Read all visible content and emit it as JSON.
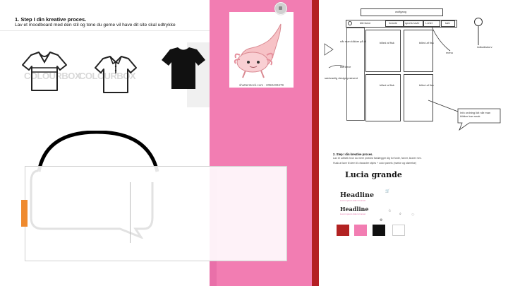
{
  "left": {
    "title": "1. Step I din kreative proces.",
    "subtitle": "Lav et moodboard med den stil og tone du gerne vil have dit site skal udtrykke",
    "watermark": "COLOURBOX"
  },
  "photo": {
    "caption": "shutterstock.com · 2050433479"
  },
  "wireframe": {
    "logo": "wolfgang",
    "nav": [
      "blå farve",
      "forside",
      "sports tavle",
      "t-shirt",
      "køb"
    ],
    "item_caption": "billed af fisk",
    "left_note_1": "når man klikker på det åbnes den",
    "left_note_2": "blå farve",
    "left_note_3": "sædvanlig design præsent",
    "menu_label": "menu",
    "cart_label": "indkøbskurv",
    "chat_note": "Info ordning lidt når man klikker kan snak"
  },
  "style": {
    "step_title": "2. Step I din kreative proces.",
    "step_sub_1": "Lav et udtræk hvor du mere præcist fastlægger dig for fonte, farver, ikoner mm.",
    "step_sub_2": "Husk at lave til dem til character styles + color panels (mørke og størrelse)",
    "font_name": "Lucia grande",
    "headline_1": "Headline",
    "headline_1_sub": "Lorem ipsum dolor sit amet",
    "headline_2": "Headline",
    "headline_2_sub": "Lorem ipsum dolor sit amet",
    "swatches": [
      "#b22222",
      "#f27db2",
      "#111111",
      "#ffffff"
    ]
  }
}
